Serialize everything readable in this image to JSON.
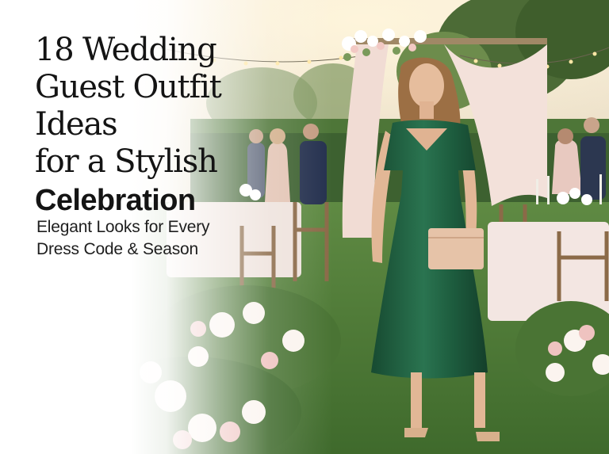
{
  "headline": {
    "line1": "18 Wedding",
    "line2": "Guest Outfit Ideas",
    "line3": "for a Stylish",
    "line4": "Celebration"
  },
  "subtitle": {
    "line1": "Elegant Looks for Every",
    "line2": "Dress Code & Season"
  },
  "colors": {
    "dress": "#1f5a3c",
    "clutch": "#e6c3a8",
    "lawn": "#4f7a38",
    "tablecloth": "#f3e6e2",
    "sky": "#f4e6cf"
  }
}
